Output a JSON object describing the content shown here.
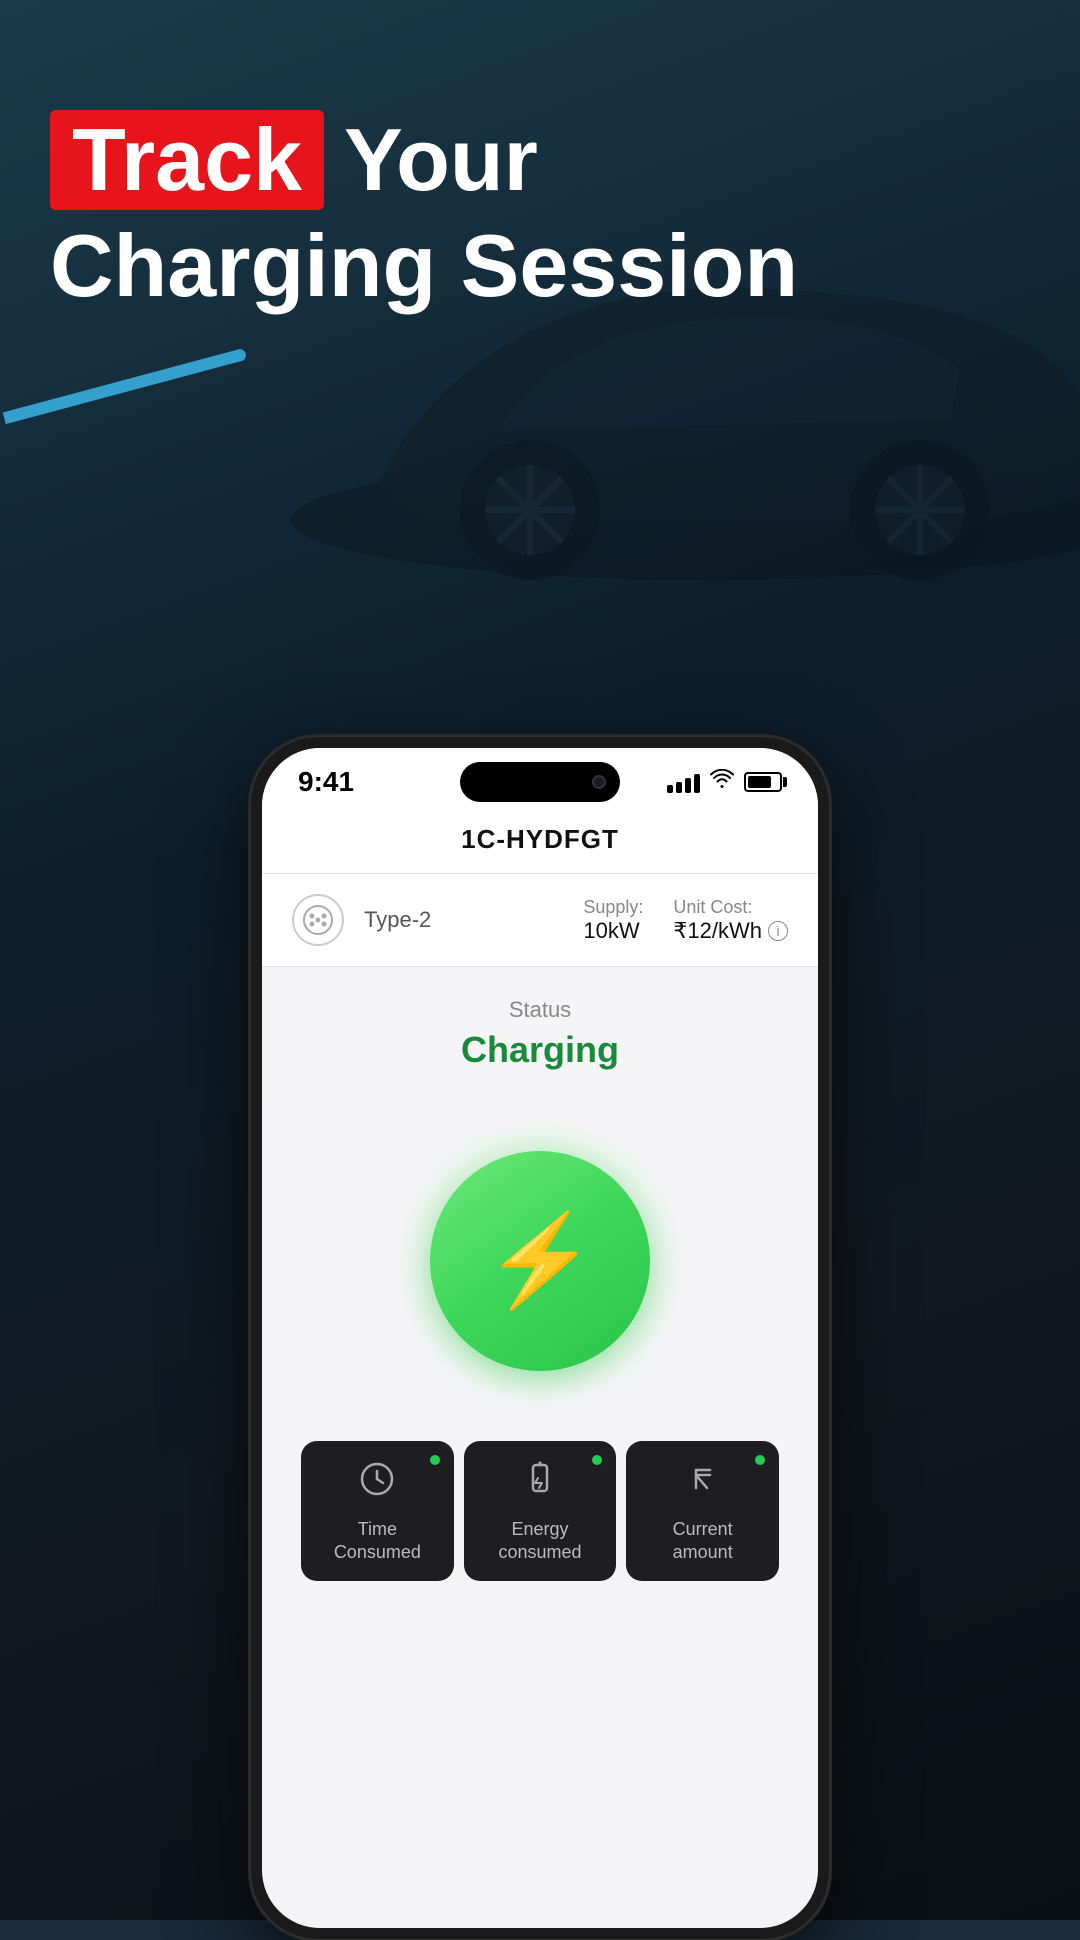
{
  "background": {
    "color_top": "#1c3a4a",
    "color_mid": "#0d1e2b",
    "color_bottom": "#0a0f15"
  },
  "header": {
    "track_badge": "Track",
    "line1_rest": "Your",
    "line2": "Charging Session"
  },
  "status_bar": {
    "time": "9:41",
    "signal_bars": [
      4,
      6,
      9,
      12,
      15
    ],
    "battery_level": "75%"
  },
  "station": {
    "id": "1C-HYDFGT",
    "connector_type": "Type-2",
    "supply_label": "Supply:",
    "supply_value": "10kW",
    "unit_cost_label": "Unit Cost:",
    "unit_cost_value": "₹12/kWh"
  },
  "charging_status": {
    "label": "Status",
    "value": "Charging"
  },
  "bottom_cards": [
    {
      "id": "time-consumed",
      "label": "Time Consumed",
      "icon": "clock"
    },
    {
      "id": "energy-consumed",
      "label": "Energy consumed",
      "icon": "battery-charge"
    },
    {
      "id": "current-amount",
      "label": "Current amount",
      "icon": "rupee"
    }
  ]
}
